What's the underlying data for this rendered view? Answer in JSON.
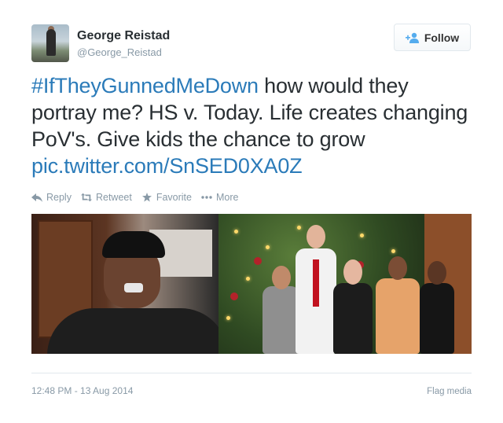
{
  "author": {
    "name": "George Reistad",
    "handle": "@George_Reistad"
  },
  "follow_button": {
    "label": "Follow",
    "icon": "add-user-icon"
  },
  "tweet": {
    "hashtag": "#IfTheyGunnedMeDown",
    "body": " how would they portray me? HS v. Today. Life creates changing PoV's. Give kids the chance to grow ",
    "link": "pic.twitter.com/SnSED0XA0Z"
  },
  "actions": {
    "reply": "Reply",
    "retweet": "Retweet",
    "favorite": "Favorite",
    "more": "More"
  },
  "footer": {
    "timestamp": "12:48 PM - 13 Aug 2014",
    "flag": "Flag media"
  },
  "colors": {
    "link": "#2b7bb9",
    "muted": "#8899a6",
    "text": "#292f33"
  }
}
